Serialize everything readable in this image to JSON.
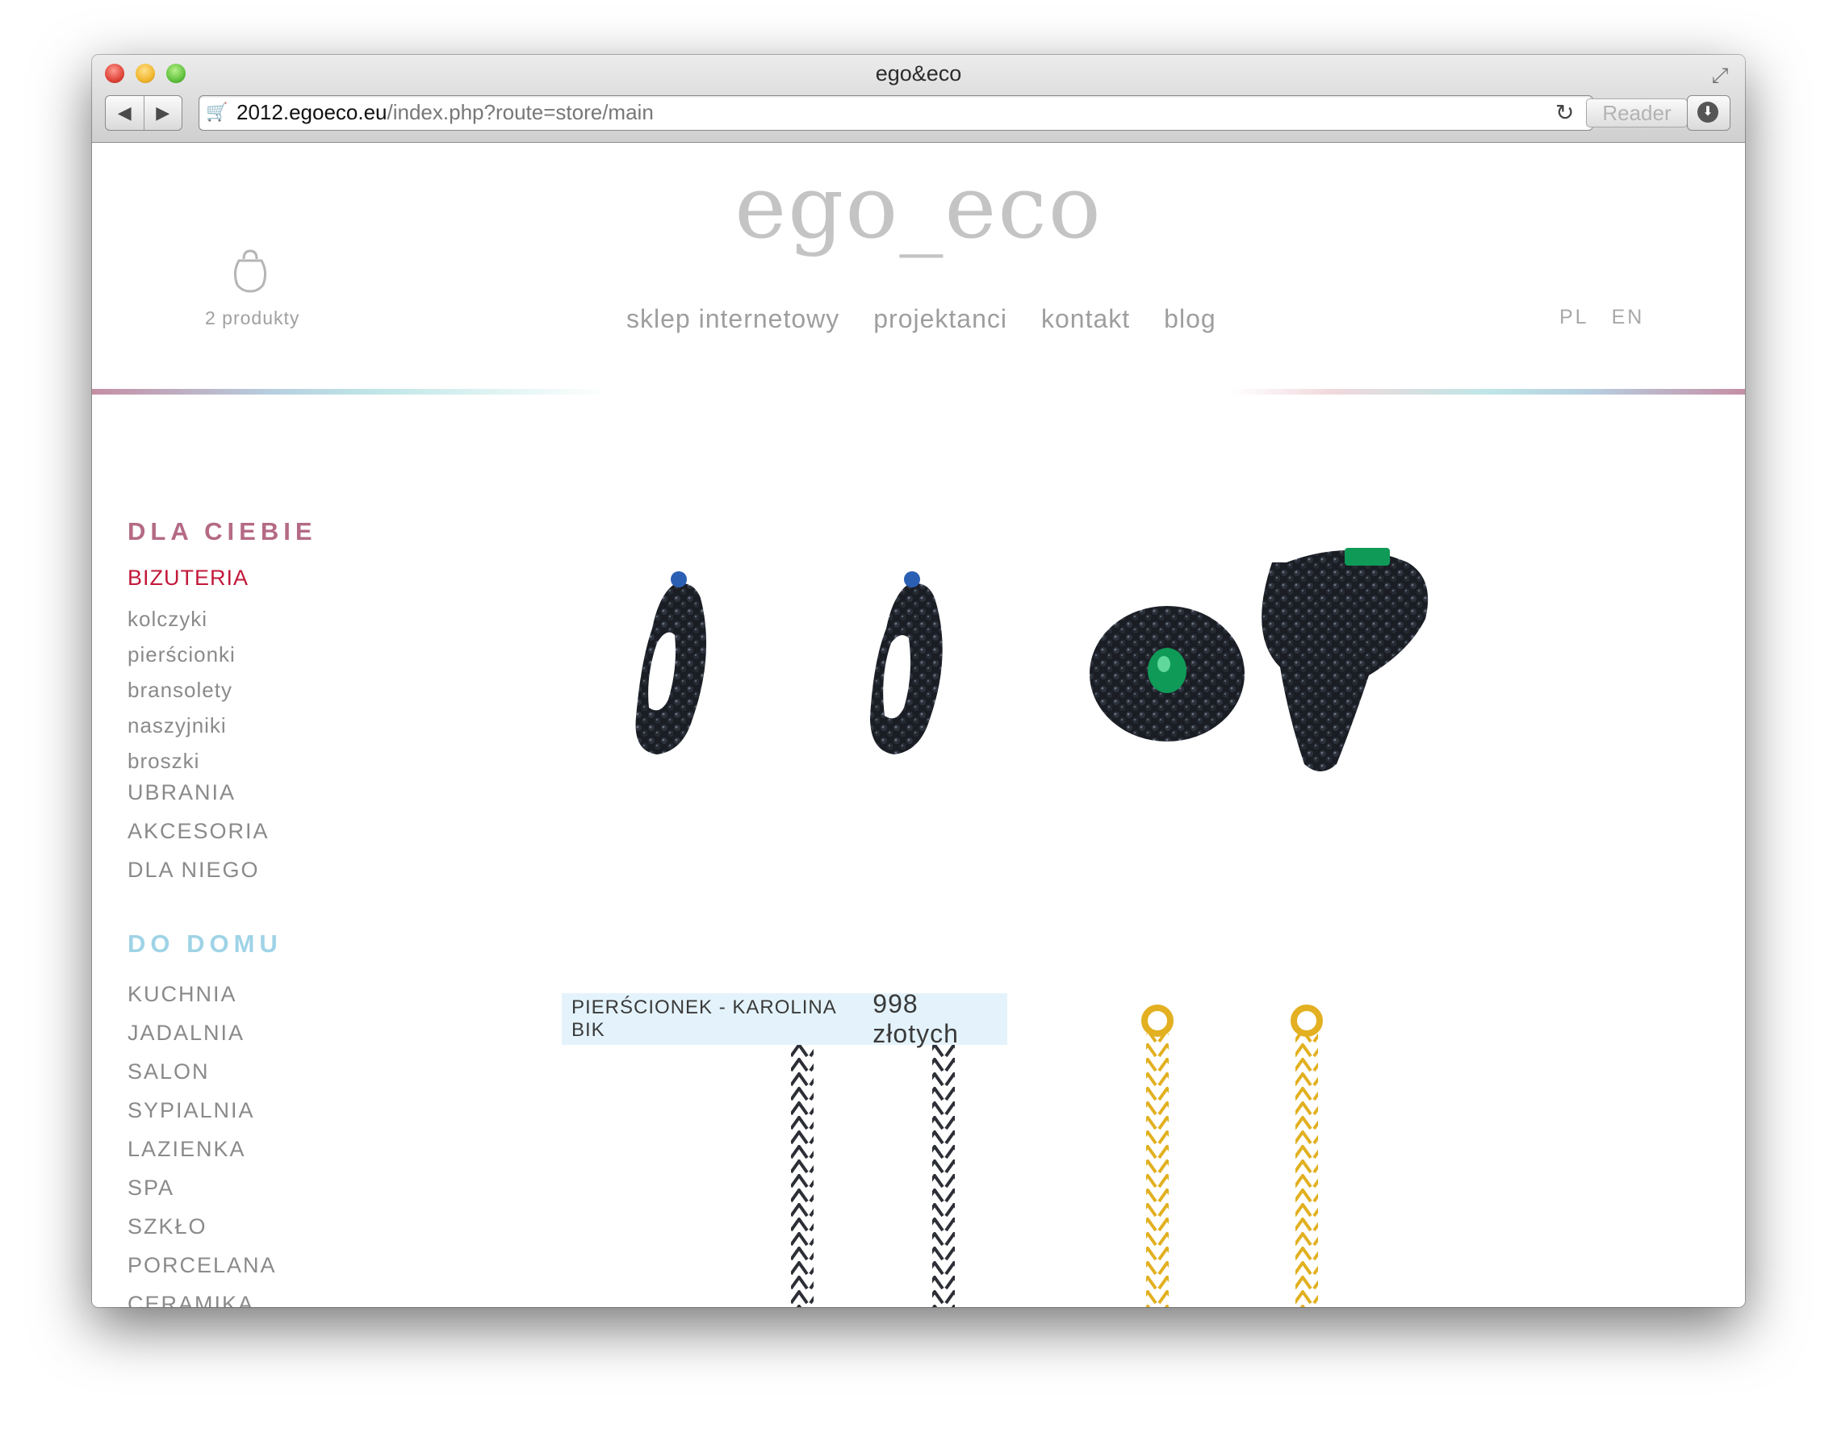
{
  "browser": {
    "title": "ego&eco",
    "url_host": "2012.egoeco.eu",
    "url_path": "/index.php?route=store/main",
    "reader_label": "Reader"
  },
  "header": {
    "logo": "ego_eco",
    "cart_count": "2 produkty",
    "nav": [
      "sklep internetowy",
      "projektanci",
      "kontakt",
      "blog"
    ],
    "languages": [
      "PL",
      "EN"
    ]
  },
  "sidebar": {
    "section1_title": "DLA CIEBIE",
    "active_category": "BIZUTERIA",
    "subcategories": [
      "kolczyki",
      "pierścionki",
      "bransolety",
      "naszyjniki",
      "broszki"
    ],
    "categories1": [
      "UBRANIA",
      "AKCESORIA",
      "DLA NIEGO"
    ],
    "section2_title": "DO DOMU",
    "categories2": [
      "KUCHNIA",
      "JADALNIA",
      "SALON",
      "SYPIALNIA",
      "LAZIENKA",
      "SPA",
      "SZKŁO",
      "PORCELANA",
      "CERAMIKA"
    ]
  },
  "products": {
    "hover_name": "PIERŚCIONEK - KAROLINA BIK",
    "hover_price": "998 złotych"
  },
  "colors": {
    "accent_pink": "#b46a85",
    "accent_blue": "#9fd3e6",
    "active_red": "#c2183a",
    "tag_bg": "#e4f3fb"
  }
}
